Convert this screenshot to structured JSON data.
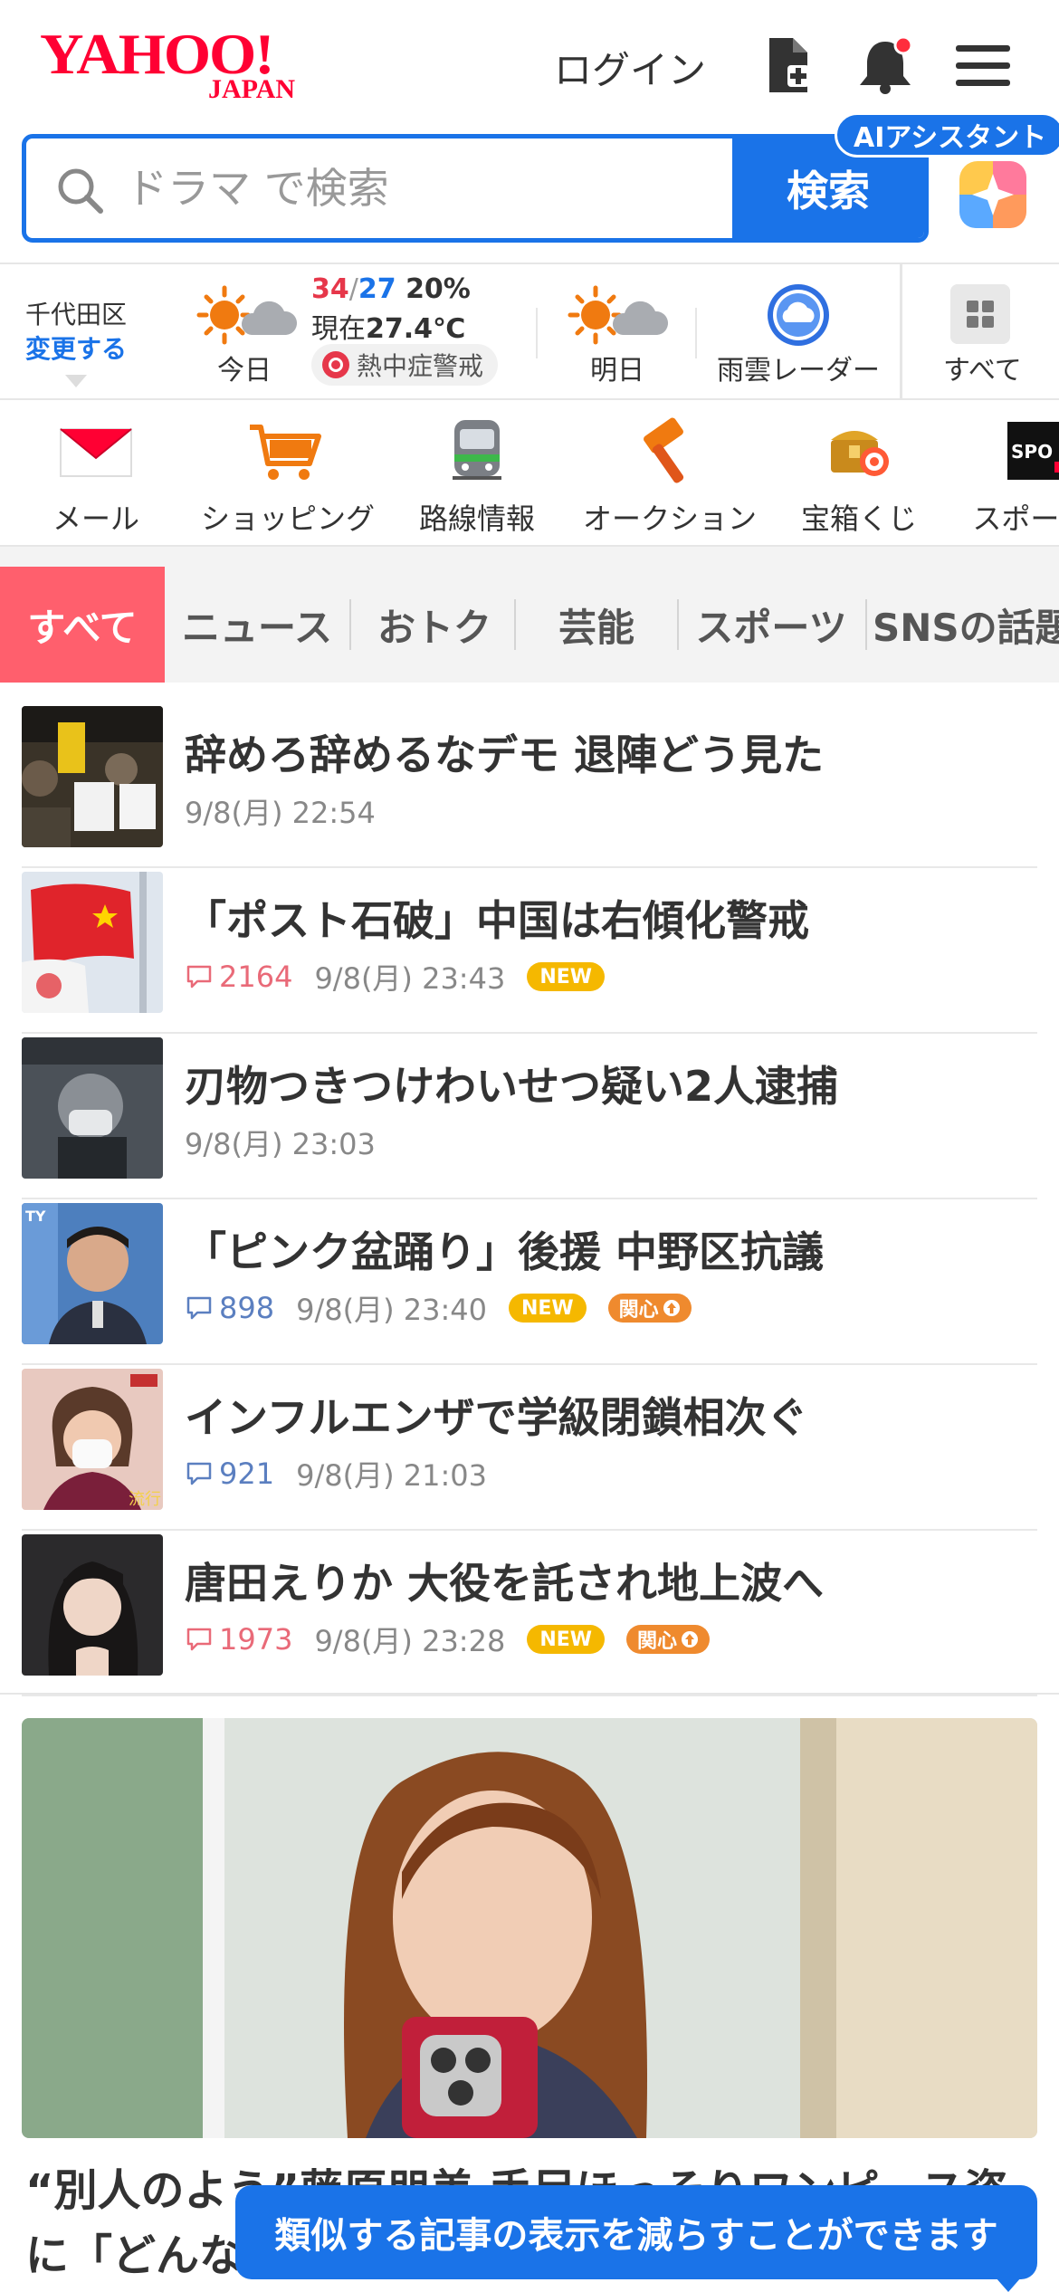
{
  "header": {
    "logo_main": "YAHOO!",
    "logo_sub": "JAPAN",
    "login": "ログイン"
  },
  "search": {
    "placeholder": "ドラマ で検索",
    "button": "検索",
    "ai_badge": "AIアシスタント"
  },
  "weather": {
    "location": "千代田区",
    "change": "変更する",
    "today_label": "今日",
    "high": "34",
    "slash": "/",
    "low": "27",
    "precip": "20%",
    "now_prefix": "現在",
    "now_temp": "27.4℃",
    "alert": "熱中症警戒",
    "tomorrow_label": "明日",
    "radar_label": "雨雲レーダー",
    "all_label": "すべて"
  },
  "services": [
    {
      "label": "メール",
      "icon": "mail-icon"
    },
    {
      "label": "ショッピング",
      "icon": "cart-icon"
    },
    {
      "label": "路線情報",
      "icon": "train-icon"
    },
    {
      "label": "オークション",
      "icon": "auction-hammer-icon"
    },
    {
      "label": "宝箱くじ",
      "icon": "treasure-box-icon"
    },
    {
      "label": "スポーツ",
      "icon": "sports-icon"
    }
  ],
  "tabs": [
    "すべて",
    "ニュース",
    "おトク",
    "芸能",
    "スポーツ",
    "SNSの話題"
  ],
  "news": [
    {
      "title": "辞めろ辞めるなデモ 退陣どう見た",
      "comments": "",
      "time": "9/8(月) 22:54",
      "new": false,
      "interest": false
    },
    {
      "title": "「ポスト石破」中国は右傾化警戒",
      "comments": "2164",
      "time": "9/8(月) 23:43",
      "new": true,
      "interest": false
    },
    {
      "title": "刃物つきつけわいせつ疑い2人逮捕",
      "comments": "",
      "time": "9/8(月) 23:03",
      "new": false,
      "interest": false
    },
    {
      "title": "「ピンク盆踊り」後援 中野区抗議",
      "comments": "898",
      "time": "9/8(月) 23:40",
      "new": true,
      "interest": true
    },
    {
      "title": "インフルエンザで学級閉鎖相次ぐ",
      "comments": "921",
      "time": "9/8(月) 21:03",
      "new": false,
      "interest": false
    },
    {
      "title": "唐田えりか 大役を託され地上波へ",
      "comments": "1973",
      "time": "9/8(月) 23:28",
      "new": true,
      "interest": true
    }
  ],
  "badges": {
    "new": "NEW",
    "interest": "関心"
  },
  "feature": {
    "title_line1": "“別人のよう”藤原朋美 手足ほっそりワンピース姿",
    "title_line2": "に「どんな"
  },
  "toast": "類似する記事の表示を減らすことができます",
  "colors": {
    "brand_red": "#ff0033",
    "accent_blue": "#1a73e8",
    "tab_active": "#ff5f6d"
  }
}
